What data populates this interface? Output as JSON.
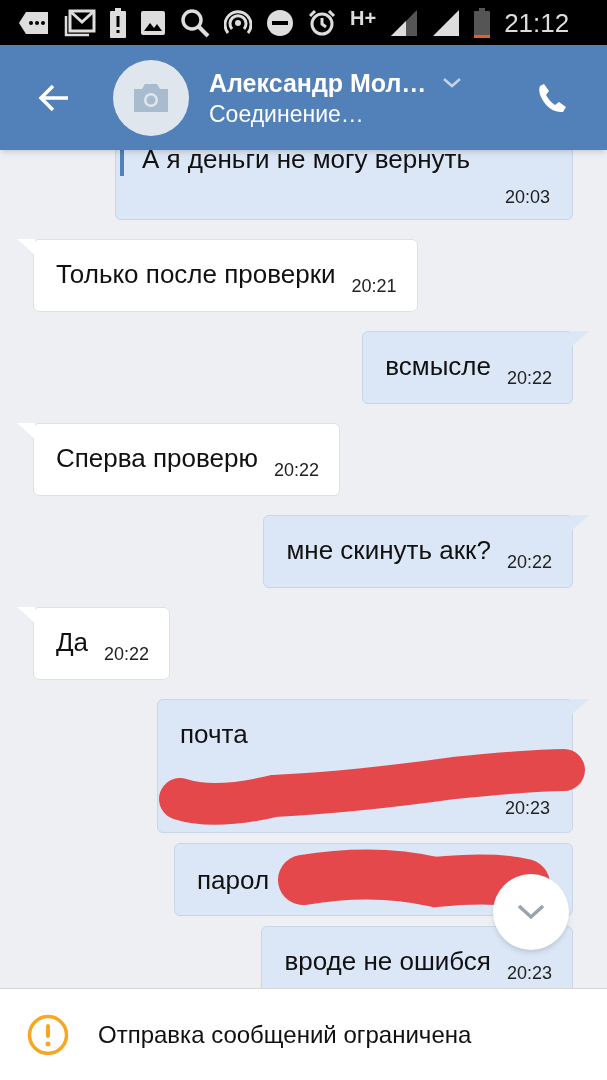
{
  "status_bar": {
    "network": "H+",
    "time": "21:12"
  },
  "header": {
    "title": "Александр Мол…",
    "subtitle": "Соединение…"
  },
  "messages": [
    {
      "kind": "reply",
      "outgoing": true,
      "quote": "А я деньги не могу вернуть",
      "time": "20:03"
    },
    {
      "kind": "plain",
      "outgoing": false,
      "text": "Только после проверки",
      "time": "20:21"
    },
    {
      "kind": "plain",
      "outgoing": true,
      "text": "всмысле",
      "time": "20:22"
    },
    {
      "kind": "plain",
      "outgoing": false,
      "text": "Сперва проверю",
      "time": "20:22"
    },
    {
      "kind": "plain",
      "outgoing": true,
      "text": "мне скинуть акк?",
      "time": "20:22"
    },
    {
      "kind": "plain",
      "outgoing": false,
      "text": "Да",
      "time": "20:22"
    },
    {
      "kind": "redacted",
      "outgoing": true,
      "text": "почта",
      "time": "20:23"
    },
    {
      "kind": "redacted",
      "outgoing": true,
      "text": "парол"
    },
    {
      "kind": "plain",
      "outgoing": true,
      "text": "вроде не ошибся",
      "time": "20:23"
    }
  ],
  "notice": {
    "text": "Отправка сообщений ограничена"
  }
}
